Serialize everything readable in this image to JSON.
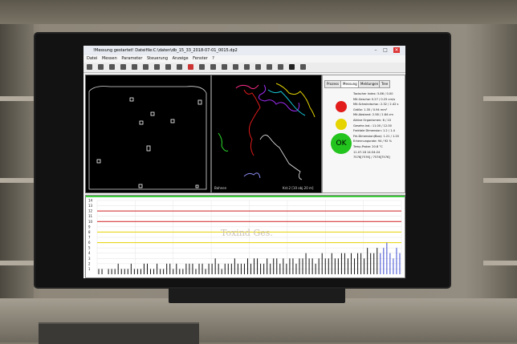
{
  "window": {
    "title": "!Messung gestartet! Dateifile:C:\\daten\\db_15_33_2018-07-01_0015.dp2",
    "controls": [
      "–",
      "□",
      "✕"
    ]
  },
  "menu": {
    "items": [
      "Datei",
      "Messen",
      "Parameter",
      "Steuerung",
      "Anzeige",
      "Fenster",
      "?"
    ]
  },
  "toolbar": {
    "icon_count": 20
  },
  "panel_track": {
    "caption_left": "Bahnen",
    "caption_right": "Kst.2 [10 obj.20 m]"
  },
  "info_panel": {
    "tabs": [
      "Prozess",
      "Messung",
      "Meldungen",
      "Tree"
    ],
    "active_tab": "Messung",
    "lines": [
      "Toxischer Index: 5.86 / 0.00",
      "Mit.Geschw: 0.27 / 0.25 cm/s",
      "Mit.Schwindschw.: 2.32 / 2.42 s",
      "Größe: 1.35 / 0.94 mm²",
      "Mit.Abstand: 2.58 / 2.84 cm",
      "Aktive Organismen: 6 / 10",
      "Gesehe.Ind.: 11.00 / 12.00",
      "Fraktale Dimension: 1.2 / 1.4",
      "Frk.Dimension(Box): 1.21 / 1.20",
      "Erkennungsrate: 94 / 92 %",
      "Temp.Probe: 20.8 °C",
      "11.07.18 14:34:24",
      "7576[7576] / 7576[7576]"
    ],
    "status_lights": [
      "red",
      "yellow",
      "green"
    ],
    "ok_label": "OK",
    "colors": {
      "red": "#e21b1b",
      "yellow": "#e6d400",
      "green": "#22c41d"
    }
  },
  "chart_data": {
    "type": "bar",
    "watermark": "Toxind Ges.",
    "y_ticks": [
      "14",
      "13",
      "12",
      "11",
      "10",
      "9",
      "8",
      "7",
      "6",
      "5",
      "4",
      "3",
      "2",
      "1"
    ],
    "ylim": [
      0,
      14
    ],
    "thresholds": [
      {
        "value": 12,
        "color": "#d12020"
      },
      {
        "value": 10,
        "color": "#d12020"
      },
      {
        "value": 8,
        "color": "#e6d400"
      },
      {
        "value": 6,
        "color": "#e6d400"
      }
    ],
    "values": [
      1,
      1,
      0,
      1,
      1,
      1,
      2,
      1,
      1,
      1,
      2,
      1,
      1,
      1,
      2,
      2,
      1,
      1,
      2,
      1,
      1,
      2,
      2,
      1,
      2,
      1,
      1,
      2,
      2,
      2,
      1,
      2,
      2,
      1,
      2,
      2,
      3,
      2,
      1,
      2,
      2,
      2,
      3,
      2,
      2,
      2,
      3,
      2,
      3,
      3,
      2,
      2,
      3,
      2,
      3,
      3,
      2,
      3,
      2,
      3,
      3,
      2,
      3,
      3,
      4,
      3,
      3,
      2,
      3,
      4,
      3,
      3,
      4,
      3,
      3,
      4,
      4,
      3,
      4,
      3,
      4,
      4,
      3,
      5,
      4,
      4,
      5,
      4,
      5,
      6,
      4,
      3,
      5,
      4
    ]
  }
}
